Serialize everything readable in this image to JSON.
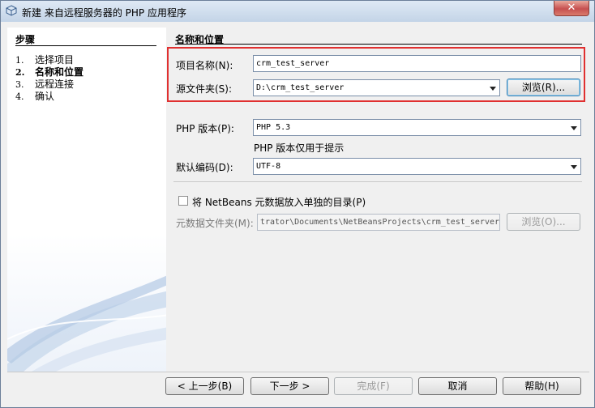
{
  "window": {
    "title": "新建 来自远程服务器的 PHP 应用程序",
    "close_label": "✕"
  },
  "steps": {
    "title": "步骤",
    "items": [
      {
        "num": "1.",
        "label": "选择项目",
        "current": false
      },
      {
        "num": "2.",
        "label": "名称和位置",
        "current": true
      },
      {
        "num": "3.",
        "label": "远程连接",
        "current": false
      },
      {
        "num": "4.",
        "label": "确认",
        "current": false
      }
    ]
  },
  "form": {
    "section_title": "名称和位置",
    "project_name_label": "项目名称(N):",
    "project_name_value": "crm_test_server",
    "source_folder_label": "源文件夹(S):",
    "source_folder_value": "D:\\crm_test_server",
    "browse_label": "浏览(R)...",
    "php_version_label": "PHP 版本(P):",
    "php_version_value": "PHP 5.3",
    "php_version_hint": "PHP 版本仅用于提示",
    "encoding_label": "默认编码(D):",
    "encoding_value": "UTF-8",
    "metadata_checkbox_label": "将 NetBeans 元数据放入单独的目录(P)",
    "metadata_checked": false,
    "metadata_folder_label": "元数据文件夹(M):",
    "metadata_folder_value": "trator\\Documents\\NetBeansProjects\\crm_test_server",
    "metadata_browse_label": "浏览(O)..."
  },
  "footer": {
    "back_label": "< 上一步(B)",
    "next_label": "下一步 >",
    "finish_label": "完成(F)",
    "cancel_label": "取消",
    "help_label": "帮助(H)"
  },
  "colors": {
    "highlight": "#e03030",
    "title_bar": "#c3d4e7",
    "close_button": "#c75050"
  }
}
